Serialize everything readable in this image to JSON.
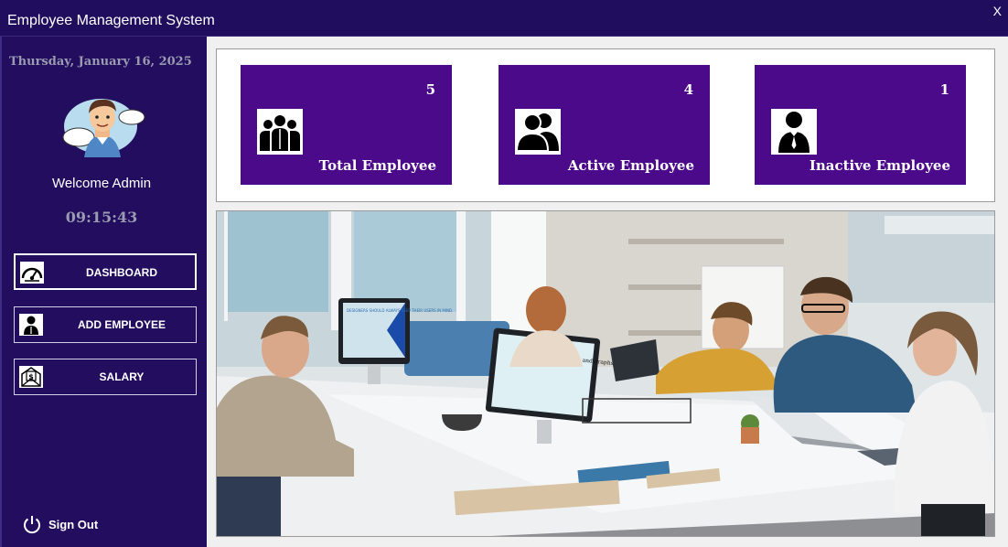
{
  "window": {
    "title": "Employee Management System",
    "close_label": "X"
  },
  "sidebar": {
    "date": "Thursday, January 16, 2025",
    "welcome": "Welcome Admin",
    "time": "09:15:43",
    "nav": [
      {
        "label": "DASHBOARD",
        "icon": "speedometer-icon",
        "active": true
      },
      {
        "label": "ADD EMPLOYEE",
        "icon": "person-icon",
        "active": false
      },
      {
        "label": "SALARY",
        "icon": "money-icon",
        "active": false
      }
    ],
    "signout_label": "Sign Out"
  },
  "stats": [
    {
      "count": "5",
      "label": "Total Employee",
      "icon": "group-icon"
    },
    {
      "count": "4",
      "label": "Active Employee",
      "icon": "two-users-icon"
    },
    {
      "count": "1",
      "label": "Inactive Employee",
      "icon": "single-user-icon"
    }
  ],
  "photo": {
    "screen_text_1": "DESIGNERS SHOULD ALWAYS KEEP THEIR USERS IN MIND.",
    "screen_text_2": "Use relevant charts and graphs"
  },
  "colors": {
    "titlebar": "#210d5e",
    "sidebar": "#220d5f",
    "card": "#4b0a8a"
  }
}
